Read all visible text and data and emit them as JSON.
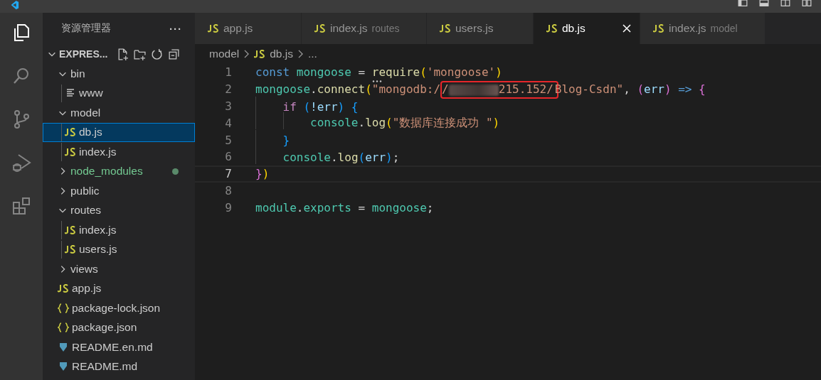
{
  "sidebar": {
    "title": "资源管理器",
    "more": "···",
    "root": {
      "label": "EXPRES...",
      "expanded": true
    },
    "items": [
      {
        "label": "bin",
        "kind": "folder",
        "expanded": true,
        "selected": false,
        "children": [
          {
            "label": "www",
            "kind": "text",
            "selected": false
          }
        ]
      },
      {
        "label": "model",
        "kind": "folder",
        "expanded": true,
        "selected": false,
        "children": [
          {
            "label": "db.js",
            "kind": "js",
            "selected": true
          },
          {
            "label": "index.js",
            "kind": "js",
            "selected": false
          }
        ]
      },
      {
        "label": "node_modules",
        "kind": "folder",
        "expanded": false,
        "selected": false,
        "git_dot": true
      },
      {
        "label": "public",
        "kind": "folder",
        "expanded": false,
        "selected": false
      },
      {
        "label": "routes",
        "kind": "folder",
        "expanded": true,
        "selected": false,
        "children": [
          {
            "label": "index.js",
            "kind": "js",
            "selected": false
          },
          {
            "label": "users.js",
            "kind": "js",
            "selected": false
          }
        ]
      },
      {
        "label": "views",
        "kind": "folder",
        "expanded": false,
        "selected": false
      },
      {
        "label": "app.js",
        "kind": "js",
        "selected": false
      },
      {
        "label": "package-lock.json",
        "kind": "json",
        "selected": false
      },
      {
        "label": "package.json",
        "kind": "json",
        "selected": false
      },
      {
        "label": "README.en.md",
        "kind": "markdown",
        "selected": false
      },
      {
        "label": "README.md",
        "kind": "markdown",
        "selected": false
      }
    ]
  },
  "tabs": [
    {
      "label": "app.js",
      "selected": false
    },
    {
      "label": "index.js",
      "description": "routes",
      "selected": false
    },
    {
      "label": "users.js",
      "selected": false
    },
    {
      "label": "db.js",
      "selected": true
    },
    {
      "label": "index.js",
      "description": "model",
      "selected": false
    }
  ],
  "breadcrumb": [
    {
      "label": "model",
      "kind": "folder"
    },
    {
      "label": "db.js",
      "kind": "js"
    },
    {
      "label": "...",
      "kind": "symbol"
    }
  ],
  "code": [
    {
      "number": "1",
      "current": false,
      "tokens": [
        {
          "text": "const",
          "kind": "keyword",
          "space_after": true
        },
        {
          "text": "mongoose",
          "kind": "variable"
        },
        {
          "text": " = ",
          "kind": "plain"
        },
        {
          "text": "require",
          "kind": "function",
          "hint": true
        },
        {
          "text": "(",
          "kind": "paren"
        },
        {
          "text": "'mongoose'",
          "kind": "string"
        },
        {
          "text": ")",
          "kind": "paren"
        }
      ]
    },
    {
      "number": "2",
      "current": false,
      "tokens": [
        {
          "text": "mongoose",
          "kind": "variable"
        },
        {
          "text": ".",
          "kind": "plain"
        },
        {
          "text": "connect",
          "kind": "function"
        },
        {
          "text": "(",
          "kind": "paren"
        },
        {
          "text": "\"mongodb:/",
          "kind": "string"
        },
        {
          "kind": "box",
          "tokens": [
            {
              "text": "/",
              "kind": "string"
            },
            {
              "kind": "blur"
            },
            {
              "text": "215.152/",
              "kind": "string"
            }
          ]
        },
        {
          "text": "Blog-Csdn\"",
          "kind": "string"
        },
        {
          "text": ",",
          "kind": "plain",
          "space_after": true
        },
        {
          "text": "(",
          "kind": "paren2"
        },
        {
          "text": "err",
          "kind": "param"
        },
        {
          "text": ")",
          "kind": "paren2",
          "space_after": true
        },
        {
          "text": "=>",
          "kind": "keyword",
          "space_after": true
        },
        {
          "text": "{",
          "kind": "paren2"
        }
      ]
    },
    {
      "number": "3",
      "current": false,
      "tokens": [
        {
          "kind": "indent"
        },
        {
          "text": "if",
          "kind": "control",
          "space_after": true
        },
        {
          "text": "(",
          "kind": "paren3"
        },
        {
          "text": "!err",
          "kind": "param"
        },
        {
          "text": ")",
          "kind": "paren3",
          "space_after": true
        },
        {
          "text": "{",
          "kind": "paren3"
        }
      ]
    },
    {
      "number": "4",
      "current": false,
      "tokens": [
        {
          "kind": "indent"
        },
        {
          "kind": "indent"
        },
        {
          "text": "console",
          "kind": "variable"
        },
        {
          "text": ".",
          "kind": "plain"
        },
        {
          "text": "log",
          "kind": "function"
        },
        {
          "text": "(",
          "kind": "paren"
        },
        {
          "text": "\"数据库连接成功 \"",
          "kind": "string"
        },
        {
          "text": ")",
          "kind": "paren"
        }
      ]
    },
    {
      "number": "5",
      "current": false,
      "tokens": [
        {
          "kind": "indent"
        },
        {
          "text": "}",
          "kind": "paren3"
        }
      ]
    },
    {
      "number": "6",
      "current": false,
      "tokens": [
        {
          "kind": "indent"
        },
        {
          "text": "console",
          "kind": "variable"
        },
        {
          "text": ".",
          "kind": "plain"
        },
        {
          "text": "log",
          "kind": "function"
        },
        {
          "text": "(",
          "kind": "paren3"
        },
        {
          "text": "err",
          "kind": "param"
        },
        {
          "text": ")",
          "kind": "paren3"
        },
        {
          "text": ";",
          "kind": "plain"
        }
      ]
    },
    {
      "number": "7",
      "current": true,
      "tokens": [
        {
          "text": "}",
          "kind": "paren2"
        },
        {
          "text": ")",
          "kind": "paren"
        }
      ]
    },
    {
      "number": "8",
      "current": false
    },
    {
      "number": "9",
      "current": false,
      "tokens": [
        {
          "text": "module",
          "kind": "variable"
        },
        {
          "text": ".",
          "kind": "plain"
        },
        {
          "text": "exports",
          "kind": "variable"
        },
        {
          "text": " = ",
          "kind": "plain"
        },
        {
          "text": "mongoose",
          "kind": "variable"
        },
        {
          "text": ";",
          "kind": "plain"
        }
      ]
    }
  ]
}
